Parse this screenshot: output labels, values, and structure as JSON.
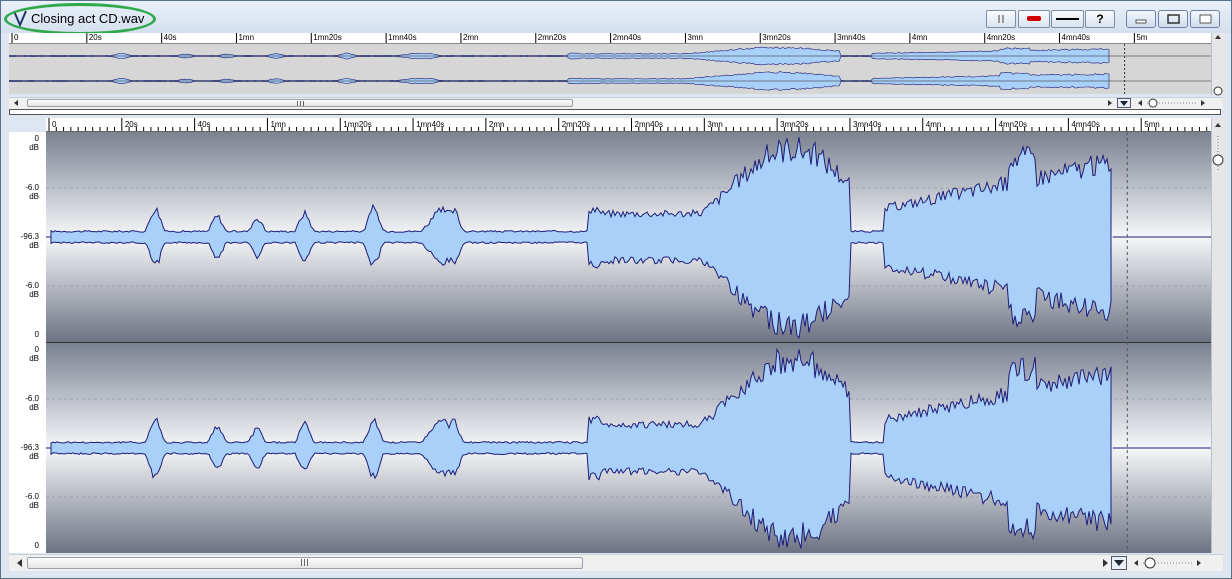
{
  "window": {
    "title": "Closing act CD.wav",
    "accent_oval_color": "#2ea84a",
    "wave_fill_color": "#a9d0f8",
    "wave_line_color": "#1c1c7a"
  },
  "toolbar": {
    "buttons": [
      {
        "name": "pause-button",
        "icon": "pause-icon"
      },
      {
        "name": "record-button",
        "icon": "record-icon",
        "color": "#cc0000"
      },
      {
        "name": "line-button",
        "icon": "line-icon"
      },
      {
        "name": "help-button",
        "label": "?"
      }
    ],
    "window_controls": [
      "minimize-icon",
      "restore-icon",
      "close-icon"
    ]
  },
  "overview_ruler": {
    "ticks": [
      "0",
      "20",
      "40",
      "1mn",
      "1mn20",
      "1mn40",
      "2mn",
      "2mn20",
      "2mn40",
      "3mn",
      "3mn20",
      "3mn40",
      "4mn",
      "4mn20",
      "4mn40",
      "5"
    ],
    "tick_suffix": [
      "",
      "s",
      "s",
      "",
      "s",
      "s",
      "",
      "s",
      "s",
      "",
      "s",
      "s",
      "",
      "s",
      "s",
      "m"
    ]
  },
  "main_ruler": {
    "ticks": [
      "0",
      "20s",
      "40s",
      "1mn",
      "1mn20s",
      "1mn40s",
      "2mn",
      "2mn20s",
      "2mn40s",
      "3mn",
      "3mn20s",
      "3mn40s",
      "4mn",
      "4mn20s",
      "4mn40s",
      "5mn"
    ]
  },
  "db_axis": {
    "channel_labels": [
      {
        "value": "0",
        "unit": ""
      },
      {
        "value": "-6.0",
        "unit": "dB"
      },
      {
        "value": "-96.3",
        "unit": "dB"
      },
      {
        "value": "-6.0",
        "unit": "dB"
      },
      {
        "value": "0",
        "unit": ""
      }
    ],
    "top_unit": "dB"
  },
  "cursor_time_seconds": 297,
  "audio_end_seconds": 293
}
